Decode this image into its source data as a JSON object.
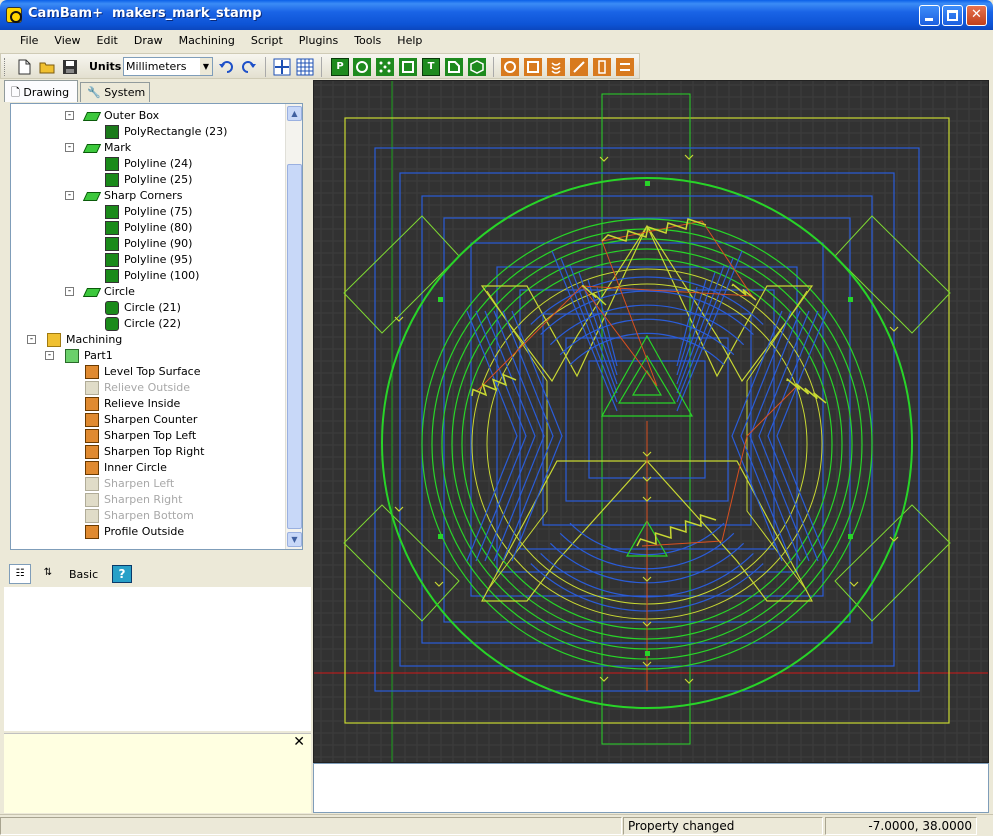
{
  "window": {
    "title": "CamBam+  makers_mark_stamp"
  },
  "menu": [
    "File",
    "View",
    "Edit",
    "Draw",
    "Machining",
    "Script",
    "Plugins",
    "Tools",
    "Help"
  ],
  "toolbar": {
    "units_label": "Units",
    "units_value": "Millimeters",
    "poly_glyph": "P",
    "text_glyph": "T"
  },
  "tabs": {
    "drawing": "Drawing",
    "system": "System"
  },
  "tree": [
    {
      "label": "Outer Box",
      "icon": "layer-icon",
      "depth": 3,
      "expander": "-",
      "disabled": false
    },
    {
      "label": "PolyRectangle (23)",
      "icon": "polyrectangle-icon",
      "depth": 4,
      "disabled": false
    },
    {
      "label": "Mark",
      "icon": "layer-icon",
      "depth": 3,
      "expander": "-",
      "disabled": false
    },
    {
      "label": "Polyline (24)",
      "icon": "polyline-icon",
      "depth": 4,
      "disabled": false
    },
    {
      "label": "Polyline (25)",
      "icon": "polyline-icon",
      "depth": 4,
      "disabled": false
    },
    {
      "label": "Sharp Corners",
      "icon": "layer-icon",
      "depth": 3,
      "expander": "-",
      "disabled": false
    },
    {
      "label": "Polyline (75)",
      "icon": "polyline-icon",
      "depth": 4,
      "disabled": false
    },
    {
      "label": "Polyline (80)",
      "icon": "polyline-icon",
      "depth": 4,
      "disabled": false
    },
    {
      "label": "Polyline (90)",
      "icon": "polyline-icon",
      "depth": 4,
      "disabled": false
    },
    {
      "label": "Polyline (95)",
      "icon": "polyline-icon",
      "depth": 4,
      "disabled": false
    },
    {
      "label": "Polyline (100)",
      "icon": "polyline-icon",
      "depth": 4,
      "disabled": false
    },
    {
      "label": "Circle",
      "icon": "layer-icon",
      "depth": 3,
      "expander": "-",
      "disabled": false
    },
    {
      "label": "Circle (21)",
      "icon": "circle-icon",
      "depth": 4,
      "disabled": false
    },
    {
      "label": "Circle (22)",
      "icon": "circle-icon",
      "depth": 4,
      "disabled": false
    },
    {
      "label": "Machining",
      "icon": "folder-icon",
      "depth": 1,
      "expander": "-",
      "disabled": false
    },
    {
      "label": "Part1",
      "icon": "part-icon",
      "depth": 2,
      "expander": "-",
      "disabled": false
    },
    {
      "label": "Level Top Surface",
      "icon": "mop-icon",
      "depth": 3,
      "disabled": false
    },
    {
      "label": "Relieve Outside",
      "icon": "mop-icon",
      "depth": 3,
      "disabled": true
    },
    {
      "label": "Relieve Inside",
      "icon": "mop-icon",
      "depth": 3,
      "disabled": false
    },
    {
      "label": "Sharpen Counter",
      "icon": "mop-icon",
      "depth": 3,
      "disabled": false
    },
    {
      "label": "Sharpen Top Left",
      "icon": "mop-icon",
      "depth": 3,
      "disabled": false
    },
    {
      "label": "Sharpen Top Right",
      "icon": "mop-icon",
      "depth": 3,
      "disabled": false
    },
    {
      "label": "Inner Circle",
      "icon": "mop-icon",
      "depth": 3,
      "disabled": false
    },
    {
      "label": "Sharpen Left",
      "icon": "mop-icon",
      "depth": 3,
      "disabled": true
    },
    {
      "label": "Sharpen Right",
      "icon": "mop-icon",
      "depth": 3,
      "disabled": true
    },
    {
      "label": "Sharpen Bottom",
      "icon": "mop-icon",
      "depth": 3,
      "disabled": true
    },
    {
      "label": "Profile Outside",
      "icon": "mop-icon",
      "depth": 3,
      "disabled": false
    }
  ],
  "properties": {
    "basic_label": "Basic",
    "help_label": "?",
    "close_glyph": "✕"
  },
  "status": {
    "message": "Property changed",
    "coords": "-7.0000, 38.0000"
  },
  "colors": {
    "canvas_bg": "#323232",
    "outline_green": "#7ed832",
    "toolpath_green": "#28d428",
    "toolpath_blue": "#2a5cd8",
    "toolpath_yellow": "#c8d832",
    "rapid_orange": "#d85020",
    "axis_red": "#d01818",
    "axis_green": "#18a018"
  }
}
